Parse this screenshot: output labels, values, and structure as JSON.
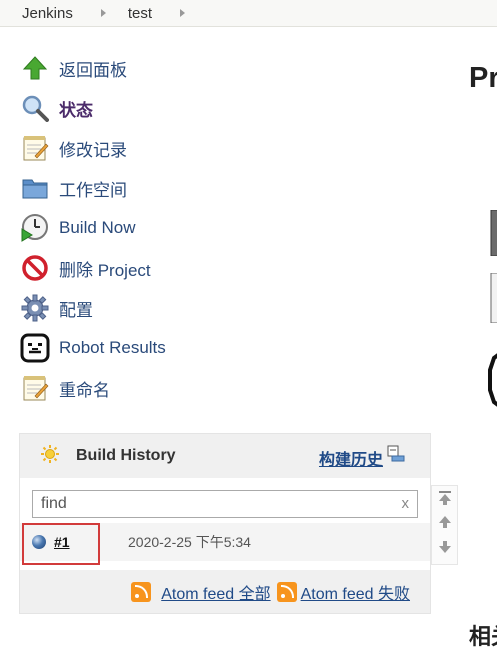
{
  "breadcrumb": {
    "items": [
      "Jenkins",
      "test"
    ]
  },
  "tasks": [
    {
      "label": "返回面板",
      "icon": "up-arrow-icon"
    },
    {
      "label": "状态",
      "icon": "magnifier-icon"
    },
    {
      "label": "修改记录",
      "icon": "notepad-icon"
    },
    {
      "label": "工作空间",
      "icon": "folder-icon"
    },
    {
      "label": "Build Now",
      "icon": "clock-play-icon"
    },
    {
      "label": "删除 Project",
      "icon": "no-entry-icon"
    },
    {
      "label": "配置",
      "icon": "gear-icon"
    },
    {
      "label": "Robot Results",
      "icon": "robot-icon"
    },
    {
      "label": "重命名",
      "icon": "notepad-icon"
    }
  ],
  "build_history": {
    "title": "Build History",
    "trend_label": "构建历史",
    "search": {
      "placeholder": "find",
      "value": "find",
      "clear": "x"
    },
    "builds": [
      {
        "number": "#1",
        "date": "2020-2-25 下午5:34",
        "status": "blue-ball-icon"
      }
    ],
    "feeds": [
      "Atom feed 全部",
      "Atom feed 失败"
    ]
  },
  "main": {
    "title": "Pr",
    "section": "相关"
  },
  "colors": {
    "link": "#204a87",
    "highlight_border": "#d23b3b",
    "rss": "#f7941d"
  }
}
